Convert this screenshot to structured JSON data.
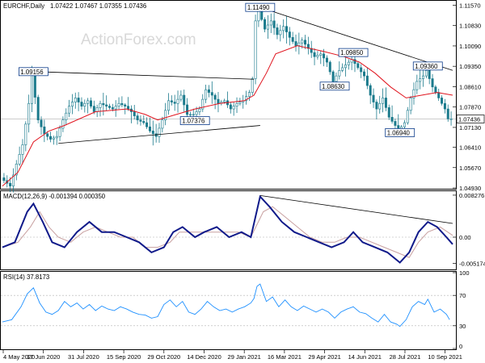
{
  "chart_data": [
    {
      "type": "candlestick",
      "panel": "price",
      "title": "EURCHF,Daily",
      "ohlc": {
        "open": "1.07422",
        "high": "1.07467",
        "low": "1.07355",
        "close": "1.07436"
      },
      "ohlc_text": "1.07422 1.07467 1.07355 1.07436",
      "watermark": "ActionForex.com",
      "ylim": [
        1.0493,
        1.117
      ],
      "yticks": [
        "1.11570",
        "1.10830",
        "1.10090",
        "1.09350",
        "1.08610",
        "1.07870",
        "1.07130",
        "1.06410",
        "1.05670",
        "1.04930"
      ],
      "current_price": "1.07436",
      "xticks": [
        "4 May 2020",
        "17 Jun 2020",
        "31 Jul 2020",
        "15 Sep 2020",
        "29 Oct 2020",
        "14 Dec 2020",
        "29 Jan 2021",
        "16 Mar 2021",
        "29 Apr 2021",
        "14 Jun 2021",
        "28 Jul 2021",
        "10 Sep 2021"
      ],
      "annotations": [
        {
          "text": "1.11490",
          "bar": 83,
          "price": 1.1149
        },
        {
          "text": "1.09156",
          "bar": 10,
          "price": 1.09156
        },
        {
          "text": "1.07376",
          "bar": 62,
          "price": 1.07376
        },
        {
          "text": "1.09850",
          "bar": 113,
          "price": 1.0985
        },
        {
          "text": "1.08630",
          "bar": 107,
          "price": 1.0863
        },
        {
          "text": "1.09360",
          "bar": 137,
          "price": 1.0936
        },
        {
          "text": "1.06940",
          "bar": 128,
          "price": 1.0694
        }
      ],
      "trendlines": [
        {
          "from": {
            "bar": 10,
            "price": 1.0916
          },
          "to": {
            "bar": 81,
            "price": 1.0888
          }
        },
        {
          "from": {
            "bar": 18,
            "price": 1.0655
          },
          "to": {
            "bar": 83,
            "price": 1.072
          }
        },
        {
          "from": {
            "bar": 83,
            "price": 1.1149
          },
          "to": {
            "bar": 145,
            "price": 1.092
          }
        }
      ],
      "close_path": [
        [
          0,
          1.053
        ],
        [
          3,
          1.05
        ],
        [
          5,
          1.058
        ],
        [
          7,
          1.065
        ],
        [
          9,
          1.08
        ],
        [
          10,
          1.0905
        ],
        [
          12,
          1.074
        ],
        [
          14,
          1.069
        ],
        [
          16,
          1.067
        ],
        [
          18,
          1.068
        ],
        [
          20,
          1.074
        ],
        [
          22,
          1.079
        ],
        [
          24,
          1.082
        ],
        [
          26,
          1.079
        ],
        [
          28,
          1.081
        ],
        [
          30,
          1.077
        ],
        [
          32,
          1.08
        ],
        [
          34,
          1.079
        ],
        [
          36,
          1.078
        ],
        [
          38,
          1.08
        ],
        [
          40,
          1.079
        ],
        [
          42,
          1.077
        ],
        [
          44,
          1.074
        ],
        [
          46,
          1.073
        ],
        [
          48,
          1.07
        ],
        [
          50,
          1.068
        ],
        [
          52,
          1.074
        ],
        [
          54,
          1.081
        ],
        [
          56,
          1.08
        ],
        [
          58,
          1.083
        ],
        [
          60,
          1.076
        ],
        [
          62,
          1.076
        ],
        [
          64,
          1.078
        ],
        [
          66,
          1.085
        ],
        [
          68,
          1.083
        ],
        [
          70,
          1.08
        ],
        [
          72,
          1.081
        ],
        [
          74,
          1.078
        ],
        [
          76,
          1.08
        ],
        [
          78,
          1.081
        ],
        [
          80,
          1.084
        ],
        [
          81,
          1.089
        ],
        [
          82,
          1.11
        ],
        [
          83,
          1.114
        ],
        [
          85,
          1.107
        ],
        [
          87,
          1.11
        ],
        [
          89,
          1.105
        ],
        [
          91,
          1.108
        ],
        [
          93,
          1.104
        ],
        [
          95,
          1.101
        ],
        [
          97,
          1.103
        ],
        [
          99,
          1.1
        ],
        [
          101,
          1.097
        ],
        [
          103,
          1.098
        ],
        [
          105,
          1.095
        ],
        [
          107,
          1.088
        ],
        [
          109,
          1.092
        ],
        [
          111,
          1.094
        ],
        [
          113,
          1.096
        ],
        [
          115,
          1.093
        ],
        [
          117,
          1.09
        ],
        [
          119,
          1.083
        ],
        [
          121,
          1.078
        ],
        [
          123,
          1.082
        ],
        [
          125,
          1.075
        ],
        [
          127,
          1.072
        ],
        [
          128,
          1.07
        ],
        [
          130,
          1.073
        ],
        [
          132,
          1.082
        ],
        [
          134,
          1.088
        ],
        [
          136,
          1.09
        ],
        [
          137,
          1.092
        ],
        [
          139,
          1.086
        ],
        [
          141,
          1.082
        ],
        [
          143,
          1.078
        ],
        [
          144,
          1.0744
        ]
      ],
      "ma_path": [
        [
          0,
          1.05
        ],
        [
          5,
          1.055
        ],
        [
          10,
          1.066
        ],
        [
          15,
          1.07
        ],
        [
          20,
          1.072
        ],
        [
          30,
          1.077
        ],
        [
          40,
          1.078
        ],
        [
          46,
          1.076
        ],
        [
          50,
          1.074
        ],
        [
          56,
          1.076
        ],
        [
          62,
          1.078
        ],
        [
          70,
          1.08
        ],
        [
          78,
          1.081
        ],
        [
          81,
          1.083
        ],
        [
          85,
          1.091
        ],
        [
          88,
          1.098
        ],
        [
          95,
          1.101
        ],
        [
          103,
          1.099
        ],
        [
          110,
          1.097
        ],
        [
          115,
          1.095
        ],
        [
          120,
          1.091
        ],
        [
          125,
          1.086
        ],
        [
          130,
          1.082
        ],
        [
          135,
          1.083
        ],
        [
          140,
          1.084
        ],
        [
          145,
          1.083
        ]
      ]
    },
    {
      "type": "line",
      "panel": "macd",
      "title": "MACD(12,26,9) -0.001394 0.000350",
      "ylim": [
        -0.0062,
        0.0089
      ],
      "yticks": [
        "0.008276",
        "0.00",
        "-0.005174"
      ],
      "current_macd": "-0.001394",
      "current_signal": "0.000350",
      "trendline": {
        "from": {
          "bar": 83,
          "value": 0.0082
        },
        "to": {
          "bar": 145,
          "value": 0.0027
        }
      },
      "macd_path": [
        [
          0,
          -0.002
        ],
        [
          4,
          -0.001
        ],
        [
          8,
          0.005
        ],
        [
          10,
          0.0066
        ],
        [
          13,
          0.003
        ],
        [
          16,
          -0.001
        ],
        [
          20,
          -0.002
        ],
        [
          24,
          0.001
        ],
        [
          28,
          0.003
        ],
        [
          32,
          0.001
        ],
        [
          36,
          0.001
        ],
        [
          40,
          0.0
        ],
        [
          44,
          -0.001
        ],
        [
          48,
          -0.003
        ],
        [
          52,
          -0.002
        ],
        [
          55,
          0.001
        ],
        [
          58,
          0.002
        ],
        [
          62,
          0.0
        ],
        [
          65,
          0.001
        ],
        [
          69,
          0.002
        ],
        [
          73,
          0.0
        ],
        [
          77,
          0.001
        ],
        [
          80,
          0.0
        ],
        [
          83,
          0.008
        ],
        [
          86,
          0.006
        ],
        [
          90,
          0.003
        ],
        [
          94,
          0.001
        ],
        [
          98,
          0.0
        ],
        [
          102,
          -0.001
        ],
        [
          106,
          -0.002
        ],
        [
          110,
          -0.001
        ],
        [
          113,
          0.001
        ],
        [
          116,
          -0.001
        ],
        [
          120,
          -0.002
        ],
        [
          124,
          -0.003
        ],
        [
          128,
          -0.005
        ],
        [
          131,
          -0.003
        ],
        [
          134,
          0.001
        ],
        [
          137,
          0.003
        ],
        [
          140,
          0.002
        ],
        [
          143,
          0.0
        ],
        [
          145,
          -0.0014
        ]
      ],
      "signal_path": [
        [
          0,
          -0.002
        ],
        [
          5,
          -0.001
        ],
        [
          9,
          0.002
        ],
        [
          12,
          0.005
        ],
        [
          15,
          0.002
        ],
        [
          18,
          0.0
        ],
        [
          22,
          -0.001
        ],
        [
          26,
          0.001
        ],
        [
          30,
          0.002
        ],
        [
          34,
          0.001
        ],
        [
          38,
          0.0
        ],
        [
          42,
          0.0
        ],
        [
          46,
          -0.002
        ],
        [
          50,
          -0.002
        ],
        [
          54,
          -0.001
        ],
        [
          57,
          0.001
        ],
        [
          61,
          0.001
        ],
        [
          64,
          0.001
        ],
        [
          68,
          0.001
        ],
        [
          72,
          0.001
        ],
        [
          76,
          0.001
        ],
        [
          80,
          0.0
        ],
        [
          84,
          0.005
        ],
        [
          87,
          0.006
        ],
        [
          91,
          0.004
        ],
        [
          95,
          0.002
        ],
        [
          99,
          0.0
        ],
        [
          103,
          -0.001
        ],
        [
          107,
          -0.001
        ],
        [
          111,
          0.0
        ],
        [
          115,
          0.0
        ],
        [
          119,
          -0.001
        ],
        [
          123,
          -0.002
        ],
        [
          127,
          -0.003
        ],
        [
          131,
          -0.004
        ],
        [
          134,
          -0.001
        ],
        [
          137,
          0.001
        ],
        [
          141,
          0.002
        ],
        [
          145,
          0.00035
        ]
      ]
    },
    {
      "type": "line",
      "panel": "rsi",
      "title": "RSI(14) 37.8173",
      "ylim": [
        0,
        100
      ],
      "yticks": [
        "100",
        "70",
        "30",
        "0"
      ],
      "levels": [
        70,
        30
      ],
      "current_rsi": "37.8173",
      "rsi_path": [
        [
          0,
          35
        ],
        [
          3,
          38
        ],
        [
          6,
          55
        ],
        [
          8,
          72
        ],
        [
          10,
          80
        ],
        [
          12,
          60
        ],
        [
          14,
          48
        ],
        [
          16,
          45
        ],
        [
          18,
          50
        ],
        [
          20,
          62
        ],
        [
          22,
          55
        ],
        [
          24,
          60
        ],
        [
          26,
          52
        ],
        [
          28,
          58
        ],
        [
          30,
          50
        ],
        [
          32,
          56
        ],
        [
          34,
          52
        ],
        [
          36,
          50
        ],
        [
          38,
          55
        ],
        [
          40,
          52
        ],
        [
          42,
          48
        ],
        [
          44,
          45
        ],
        [
          46,
          44
        ],
        [
          48,
          40
        ],
        [
          50,
          42
        ],
        [
          52,
          58
        ],
        [
          54,
          64
        ],
        [
          56,
          55
        ],
        [
          58,
          62
        ],
        [
          60,
          48
        ],
        [
          62,
          45
        ],
        [
          64,
          52
        ],
        [
          66,
          62
        ],
        [
          68,
          55
        ],
        [
          70,
          50
        ],
        [
          72,
          52
        ],
        [
          74,
          48
        ],
        [
          76,
          52
        ],
        [
          78,
          55
        ],
        [
          80,
          60
        ],
        [
          81,
          66
        ],
        [
          82,
          82
        ],
        [
          83,
          85
        ],
        [
          85,
          62
        ],
        [
          87,
          68
        ],
        [
          89,
          55
        ],
        [
          91,
          64
        ],
        [
          93,
          55
        ],
        [
          95,
          50
        ],
        [
          97,
          56
        ],
        [
          99,
          52
        ],
        [
          101,
          48
        ],
        [
          103,
          52
        ],
        [
          105,
          48
        ],
        [
          107,
          40
        ],
        [
          109,
          48
        ],
        [
          111,
          52
        ],
        [
          113,
          55
        ],
        [
          115,
          48
        ],
        [
          117,
          46
        ],
        [
          119,
          40
        ],
        [
          121,
          35
        ],
        [
          123,
          45
        ],
        [
          125,
          35
        ],
        [
          127,
          32
        ],
        [
          128,
          29
        ],
        [
          130,
          38
        ],
        [
          132,
          55
        ],
        [
          134,
          62
        ],
        [
          136,
          58
        ],
        [
          137,
          65
        ],
        [
          139,
          48
        ],
        [
          141,
          52
        ],
        [
          143,
          45
        ],
        [
          144,
          38
        ]
      ]
    }
  ]
}
